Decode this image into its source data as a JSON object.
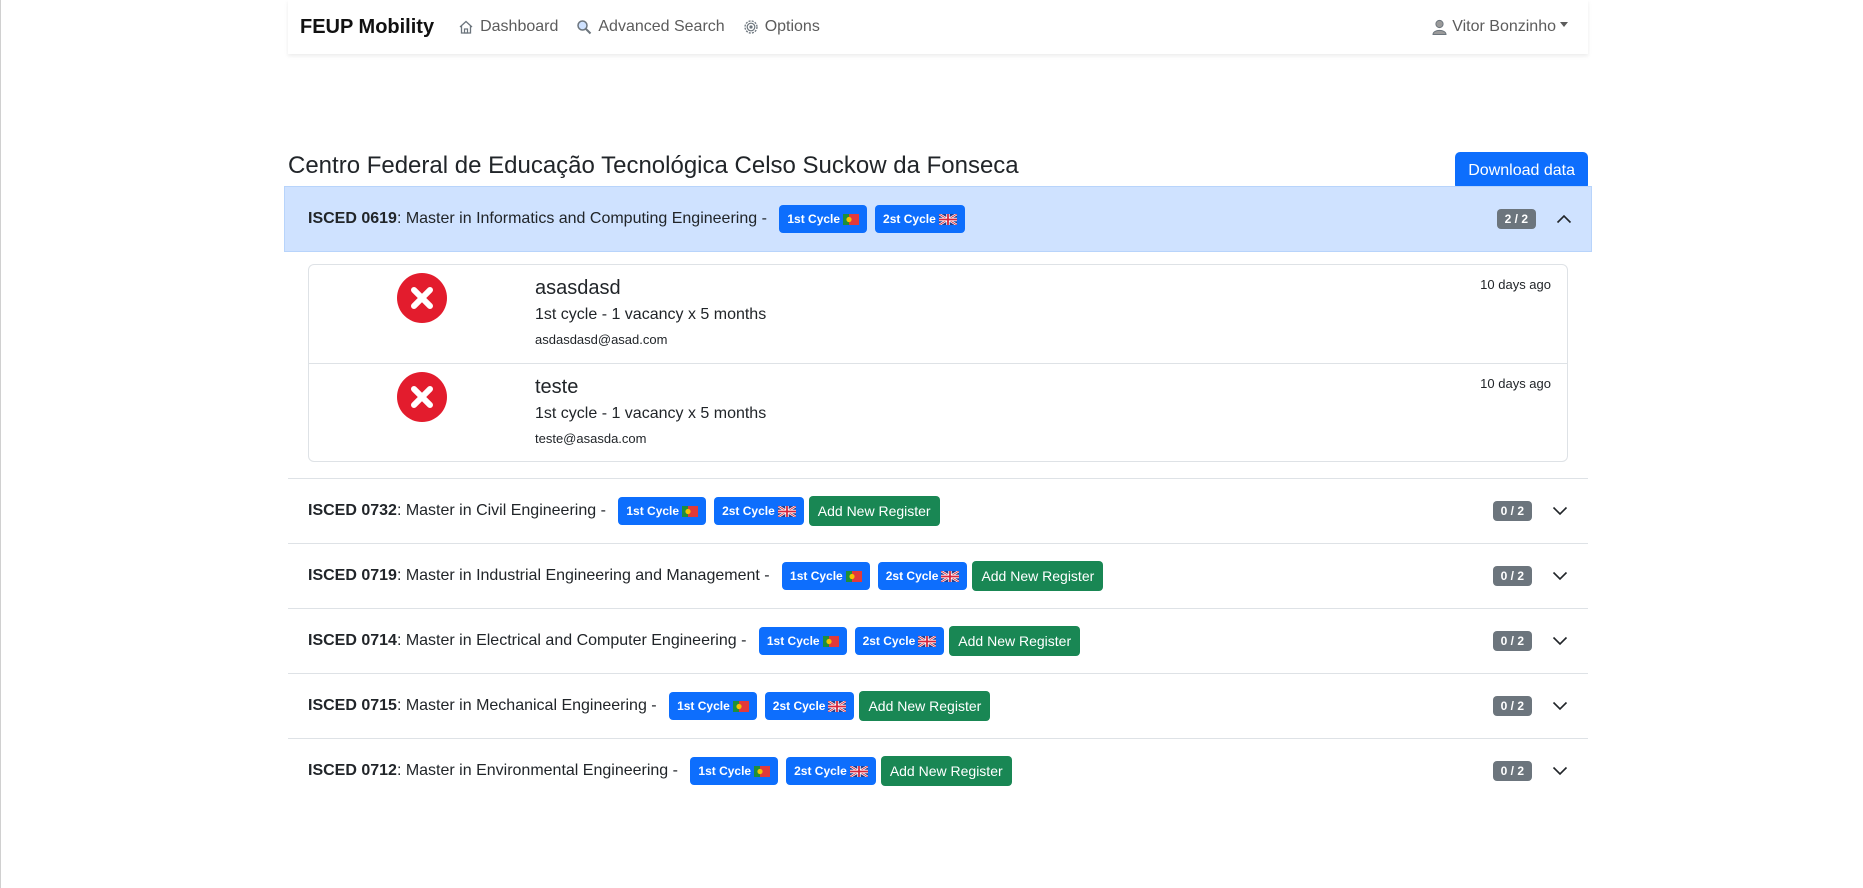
{
  "navbar": {
    "brand": "FEUP Mobility",
    "links": [
      {
        "label": "Dashboard",
        "icon": "home-icon"
      },
      {
        "label": "Advanced Search",
        "icon": "search-icon"
      },
      {
        "label": "Options",
        "icon": "gear-icon"
      }
    ],
    "user": "Vitor Bonzinho"
  },
  "page": {
    "title": "Centro Federal de Educação Tecnológica Celso Suckow da Fonseca",
    "download_label": "Download data"
  },
  "colors": {
    "primary": "#0d6efd",
    "success": "#198754",
    "danger": "#e31c2d",
    "secondary": "#6c757d",
    "open_header": "#cfe2ff"
  },
  "courses": [
    {
      "code": "ISCED 0619",
      "name": ": Master in Informatics and Computing Engineering - ",
      "badge1": "1st Cycle",
      "badge2": "2st Cycle",
      "count": "2 / 2",
      "registers": [
        {
          "name": "asasdasd",
          "desc": "1st cycle - 1 vacancy x 5 months",
          "email": "asdasdasd@asad.com",
          "time": "10 days ago",
          "status_icon": "x-circle-icon"
        },
        {
          "name": "teste",
          "desc": "1st cycle - 1 vacancy x 5 months",
          "email": "teste@asasda.com",
          "time": "10 days ago",
          "status_icon": "x-circle-icon"
        }
      ]
    },
    {
      "code": "ISCED 0732",
      "name": ": Master in Civil Engineering - ",
      "badge1": "1st Cycle",
      "badge2": "2st Cycle",
      "add_label": "Add New Register",
      "count": "0 / 2"
    },
    {
      "code": "ISCED 0719",
      "name": ": Master in Industrial Engineering and Management - ",
      "badge1": "1st Cycle",
      "badge2": "2st Cycle",
      "add_label": "Add New Register",
      "count": "0 / 2"
    },
    {
      "code": "ISCED 0714",
      "name": ": Master in Electrical and Computer Engineering - ",
      "badge1": "1st Cycle",
      "badge2": "2st Cycle",
      "add_label": "Add New Register",
      "count": "0 / 2"
    },
    {
      "code": "ISCED 0715",
      "name": ": Master in Mechanical Engineering - ",
      "badge1": "1st Cycle",
      "badge2": "2st Cycle",
      "add_label": "Add New Register",
      "count": "0 / 2"
    },
    {
      "code": "ISCED 0712",
      "name": ": Master in Environmental Engineering - ",
      "badge1": "1st Cycle",
      "badge2": "2st Cycle",
      "add_label": "Add New Register",
      "count": "0 / 2"
    }
  ]
}
